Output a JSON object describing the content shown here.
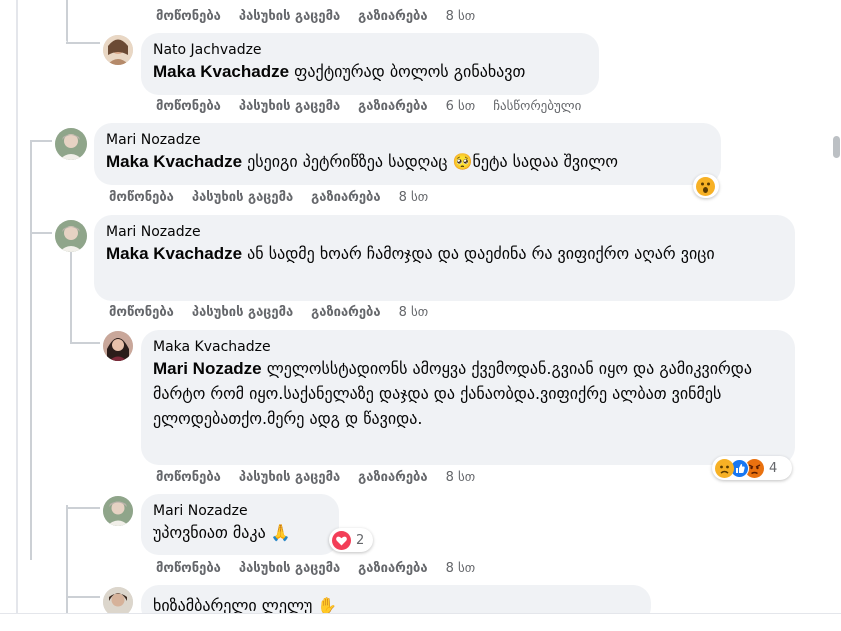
{
  "labels": {
    "like": "მოწონება",
    "reply": "პასუხის გაცემა",
    "share": "გაზიარება"
  },
  "comments": [
    {
      "time": "8 სთ"
    },
    {
      "author": "Nato Jachvadze",
      "mention": "Maka Kvachadze",
      "text": " ფაქტიურად ბოლოს გინახავთ",
      "time": "6 სთ",
      "edited": "ჩასწორებული"
    },
    {
      "author": "Mari Nozadze",
      "mention": "Maka Kvachadze",
      "text": " ესეიგი პეტრიწზეა სადღაც 🥺ნეტა სადაა შვილო",
      "time": "8 სთ",
      "reaction_icons": [
        "wow-emoji-icon"
      ]
    },
    {
      "author": "Mari Nozadze",
      "mention": "Maka Kvachadze",
      "text": " ან სადმე ხოარ ჩამოჯდა და დაეძინა რა ვიფიქრო აღარ ვიცი",
      "time": "8 სთ"
    },
    {
      "author": "Maka Kvachadze",
      "mention": "Mari Nozadze",
      "text": " ლელოსსტადიონს ამოყვა ქვემოდან.გვიან იყო და გამიკვირდა მარტო რომ იყო.საქანელაზე დაჯდა და ქანაობდა.ვიფიქრე ალბათ ვინმეს ელოდებათქო.მერე ადგ დ წავიდა.",
      "time": "8 სთ",
      "reaction_count": "4",
      "reaction_icons": [
        "sad-emoji-icon",
        "like-emoji-icon",
        "angry-emoji-icon"
      ]
    },
    {
      "author": "Mari Nozadze",
      "text": "უპოვნიათ მაკა 🙏",
      "time": "8 სთ",
      "reaction_count": "2",
      "reaction_icons": [
        "love-emoji-icon"
      ]
    },
    {
      "text": "ხიზამბარელი ლელუ ✋"
    }
  ],
  "colors": {
    "bubble": "#f0f2f5",
    "meta": "#65676b",
    "thread": "#ccd0d5"
  }
}
